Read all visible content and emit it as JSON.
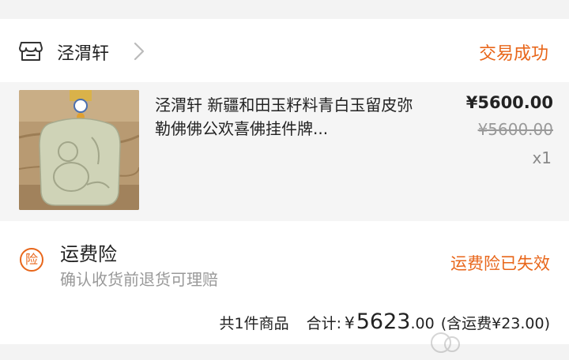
{
  "shop": {
    "name": "泾渭轩",
    "icon": "shop-icon",
    "status": "交易成功"
  },
  "product": {
    "title": "泾渭轩 新疆和田玉籽料青白玉留皮弥勒佛佛公欢喜佛挂件牌...",
    "price": "¥5600.00",
    "original_price": "¥5600.00",
    "quantity": "x1"
  },
  "insurance": {
    "icon_text": "险",
    "title": "运费险",
    "description": "确认收货前退货可理赔",
    "status": "运费险已失效"
  },
  "summary": {
    "count": "共1件商品",
    "total_label": "合计:",
    "currency": "¥",
    "total_int": "5623",
    "total_dec": ".00",
    "freight": "(含运费¥23.00)"
  },
  "colors": {
    "accent": "#e8661a",
    "muted": "#999999"
  }
}
